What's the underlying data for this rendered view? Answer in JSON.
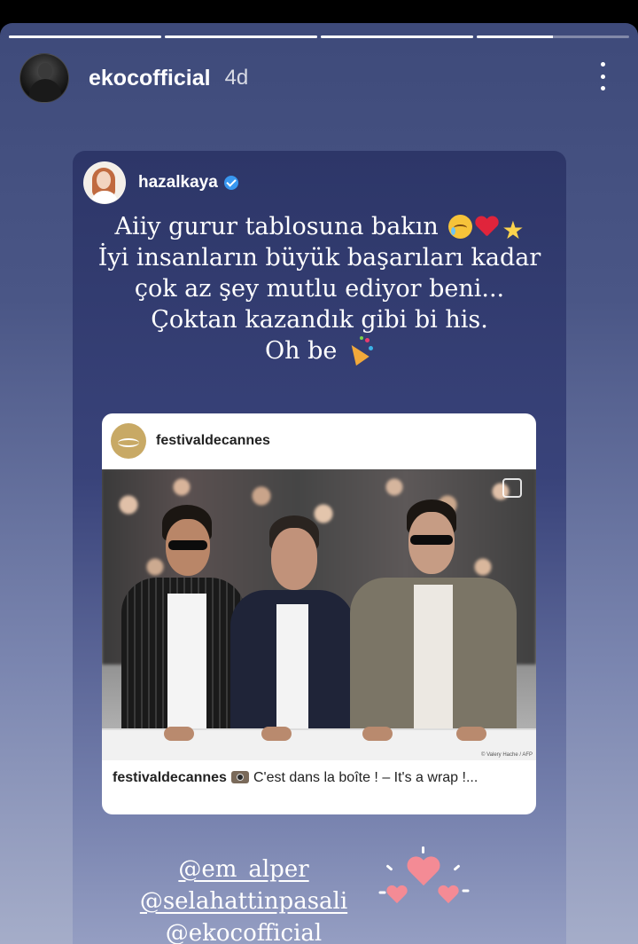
{
  "story": {
    "progress_segments": [
      1,
      1,
      1,
      0.5
    ],
    "username": "ekocofficial",
    "time_ago": "4d"
  },
  "shared_story": {
    "username": "hazalkaya",
    "verified": true,
    "quote_lines": [
      "Aiiy gurur tablosuna bakın",
      "İyi insanların büyük başarıları kadar",
      "çok az şey mutlu ediyor beni...",
      "Çoktan kazandık gibi bi his.",
      "Oh be"
    ],
    "post": {
      "username": "festivaldecannes",
      "caption_user": "festivaldecannes",
      "caption_text": "C'est dans la boîte ! – It's a wrap !...",
      "photo_credit": "© Valery Hache / AFP"
    },
    "mentions": [
      "@em_alper",
      "@selahattinpasali",
      "@ekocofficial"
    ]
  },
  "icons": {
    "menu": "more-vertical-icon",
    "verified": "verified-badge-icon",
    "emojis": [
      "crying-face",
      "red-heart",
      "glowing-star",
      "party-popper",
      "camera-flash",
      "hearts-sticker"
    ]
  },
  "colors": {
    "background_top": "#3e4a7a",
    "background_bottom": "#a5adc9",
    "verified_blue": "#3897f0"
  }
}
